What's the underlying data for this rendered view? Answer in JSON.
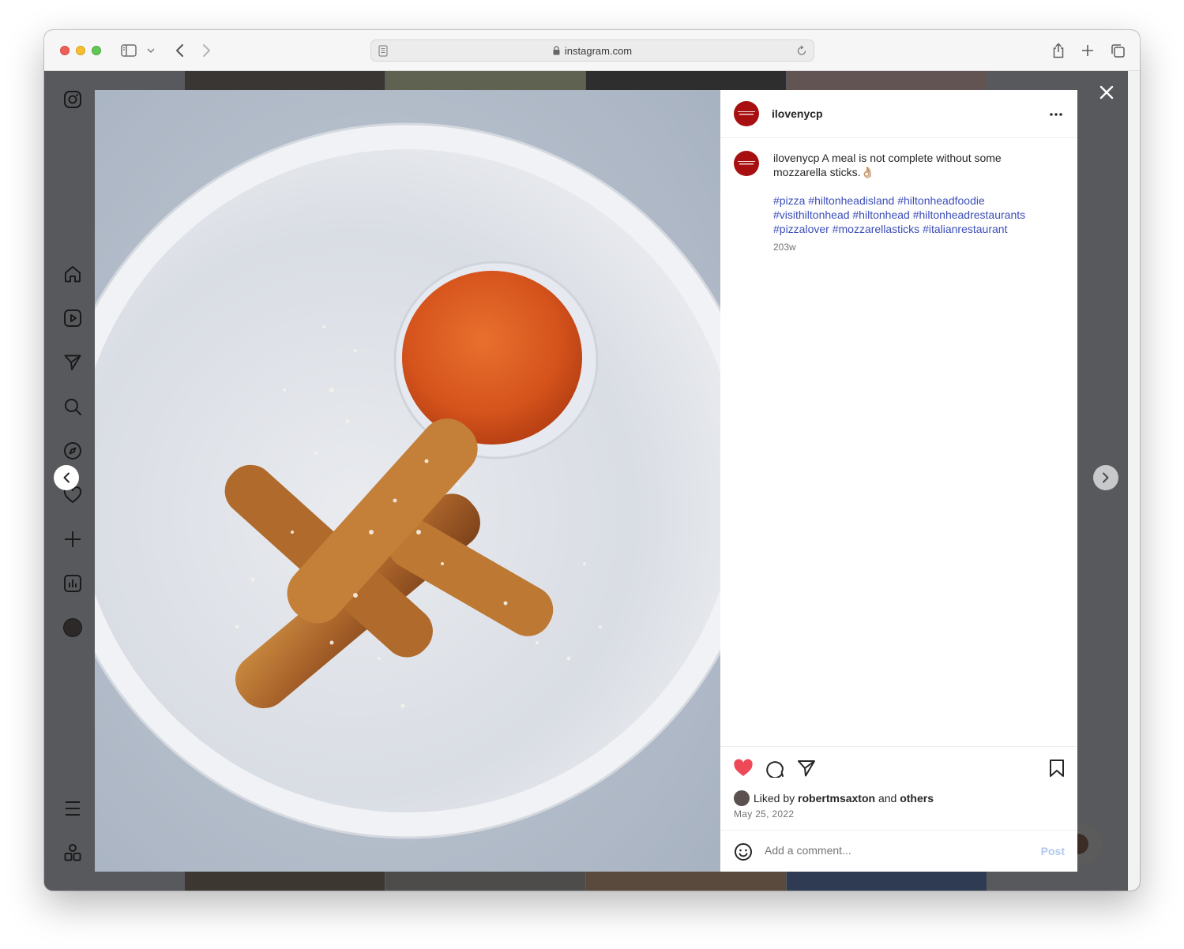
{
  "browser": {
    "url": "instagram.com"
  },
  "post": {
    "username": "ilovenycp",
    "caption_username": "ilovenycp",
    "caption_text": "A meal is not complete without some mozzarella sticks.👌🏼",
    "hashtags": "#pizza #hiltonheadisland #hiltonheadfoodie #visithiltonhead #hiltonhead #hiltonheadrestaurants #pizzalover #mozzarellasticks #italianrestaurant",
    "time_ago": "203w",
    "liked_prefix": "Liked by",
    "liked_user": "robertmsaxton",
    "liked_and": "and",
    "liked_others": "others",
    "date": "May 25, 2022",
    "comment_placeholder": "Add a comment...",
    "post_label": "Post"
  },
  "colors": {
    "like_active": "#ed4956",
    "hashtag": "#3c4eb8",
    "post_button_disabled": "#b2c8ef",
    "backdrop": "#58595d"
  },
  "icons": {
    "sidebar": [
      "instagram-logo-icon",
      "home-icon",
      "reels-icon",
      "direct-message-icon",
      "search-icon",
      "explore-icon",
      "notifications-heart-icon",
      "create-plus-icon",
      "insights-icon",
      "profile-avatar",
      "menu-icon",
      "more-apps-icon"
    ],
    "actions": [
      "heart-filled-icon",
      "comment-icon",
      "share-icon",
      "bookmark-icon"
    ]
  }
}
